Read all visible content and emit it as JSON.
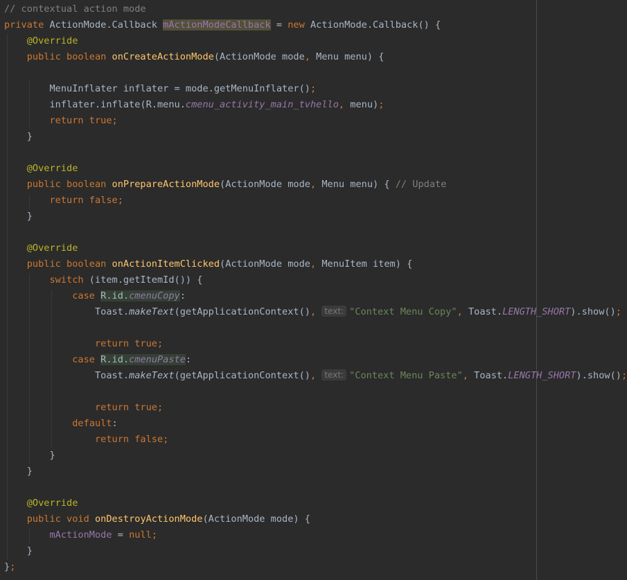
{
  "colors": {
    "background": "#2b2b2b",
    "default_text": "#a9b7c6",
    "keyword": "#cc7832",
    "comment": "#808080",
    "annotation": "#bbb529",
    "method": "#ffc66d",
    "field": "#9876aa",
    "string": "#6a8759"
  },
  "code": {
    "lines": [
      {
        "tokens": [
          {
            "t": "// contextual action mode",
            "c": "cm"
          }
        ]
      },
      {
        "tokens": [
          {
            "t": "private",
            "c": "kw"
          },
          {
            "t": " ActionMode.Callback "
          },
          {
            "t": "mActionModeCallback",
            "c": "fld hl-var"
          },
          {
            "t": " = "
          },
          {
            "t": "new",
            "c": "kw"
          },
          {
            "t": " ActionMode.Callback() {"
          }
        ]
      },
      {
        "tokens": [
          {
            "t": "    "
          },
          {
            "t": "@Override",
            "c": "an"
          }
        ]
      },
      {
        "tokens": [
          {
            "t": "    "
          },
          {
            "t": "public boolean",
            "c": "kw"
          },
          {
            "t": " "
          },
          {
            "t": "onCreateActionMode",
            "c": "fn"
          },
          {
            "t": "(ActionMode mode"
          },
          {
            "t": ",",
            "c": "kw"
          },
          {
            "t": " Menu menu) {"
          }
        ]
      },
      {
        "tokens": []
      },
      {
        "tokens": [
          {
            "t": "        MenuInflater inflater = mode.getMenuInflater()"
          },
          {
            "t": ";",
            "c": "kw"
          }
        ]
      },
      {
        "tokens": [
          {
            "t": "        inflater.inflate(R.menu."
          },
          {
            "t": "cmenu_activity_main_tvhello",
            "c": "ital"
          },
          {
            "t": ", ",
            "c": "kw"
          },
          {
            "t": "menu)"
          },
          {
            "t": ";",
            "c": "kw"
          }
        ]
      },
      {
        "tokens": [
          {
            "t": "        "
          },
          {
            "t": "return true;",
            "c": "kw"
          }
        ]
      },
      {
        "tokens": [
          {
            "t": "    }"
          }
        ]
      },
      {
        "tokens": []
      },
      {
        "tokens": [
          {
            "t": "    "
          },
          {
            "t": "@Override",
            "c": "an"
          }
        ]
      },
      {
        "tokens": [
          {
            "t": "    "
          },
          {
            "t": "public boolean",
            "c": "kw"
          },
          {
            "t": " "
          },
          {
            "t": "onPrepareActionMode",
            "c": "fn"
          },
          {
            "t": "(ActionMode mode"
          },
          {
            "t": ",",
            "c": "kw"
          },
          {
            "t": " Menu menu) { "
          },
          {
            "t": "// Update",
            "c": "cm"
          }
        ]
      },
      {
        "tokens": [
          {
            "t": "        "
          },
          {
            "t": "return false;",
            "c": "kw"
          }
        ]
      },
      {
        "tokens": [
          {
            "t": "    }"
          }
        ]
      },
      {
        "tokens": []
      },
      {
        "tokens": [
          {
            "t": "    "
          },
          {
            "t": "@Override",
            "c": "an"
          }
        ]
      },
      {
        "tokens": [
          {
            "t": "    "
          },
          {
            "t": "public boolean",
            "c": "kw"
          },
          {
            "t": " "
          },
          {
            "t": "onActionItemClicked",
            "c": "fn"
          },
          {
            "t": "(ActionMode mode"
          },
          {
            "t": ",",
            "c": "kw"
          },
          {
            "t": " MenuItem item) {"
          }
        ]
      },
      {
        "tokens": [
          {
            "t": "        "
          },
          {
            "t": "switch",
            "c": "kw"
          },
          {
            "t": " (item.getItemId()) {"
          }
        ]
      },
      {
        "tokens": [
          {
            "t": "            "
          },
          {
            "t": "case",
            "c": "kw"
          },
          {
            "t": " "
          },
          {
            "t": "R.id.",
            "c": "hl-ref"
          },
          {
            "t": "cmenuCopy",
            "c": "ital hl-ref"
          },
          {
            "t": ":"
          }
        ]
      },
      {
        "tokens": [
          {
            "t": "                Toast."
          },
          {
            "t": "makeText",
            "c": "sm"
          },
          {
            "t": "(getApplicationContext()"
          },
          {
            "t": ",",
            "c": "kw"
          },
          {
            "t": " "
          },
          {
            "t": "text:",
            "c": "hint"
          },
          {
            "t": "\"Context Menu Copy\"",
            "c": "str"
          },
          {
            "t": ",",
            "c": "kw"
          },
          {
            "t": " Toast."
          },
          {
            "t": "LENGTH_SHORT",
            "c": "ital"
          },
          {
            "t": ").show()"
          },
          {
            "t": ";",
            "c": "kw"
          }
        ]
      },
      {
        "tokens": []
      },
      {
        "tokens": [
          {
            "t": "                "
          },
          {
            "t": "return true;",
            "c": "kw"
          }
        ]
      },
      {
        "tokens": [
          {
            "t": "            "
          },
          {
            "t": "case",
            "c": "kw"
          },
          {
            "t": " "
          },
          {
            "t": "R.id.",
            "c": "hl-ref"
          },
          {
            "t": "cmenuPaste",
            "c": "ital hl-ref"
          },
          {
            "t": ":"
          }
        ]
      },
      {
        "tokens": [
          {
            "t": "                Toast."
          },
          {
            "t": "makeText",
            "c": "sm"
          },
          {
            "t": "(getApplicationContext()"
          },
          {
            "t": ",",
            "c": "kw"
          },
          {
            "t": " "
          },
          {
            "t": "text:",
            "c": "hint"
          },
          {
            "t": "\"Context Menu Paste\"",
            "c": "str"
          },
          {
            "t": ",",
            "c": "kw"
          },
          {
            "t": " Toast."
          },
          {
            "t": "LENGTH_SHORT",
            "c": "ital"
          },
          {
            "t": ").show()"
          },
          {
            "t": ";",
            "c": "kw"
          }
        ]
      },
      {
        "tokens": []
      },
      {
        "tokens": [
          {
            "t": "                "
          },
          {
            "t": "return true;",
            "c": "kw"
          }
        ]
      },
      {
        "tokens": [
          {
            "t": "            "
          },
          {
            "t": "default",
            "c": "kw"
          },
          {
            "t": ":"
          }
        ]
      },
      {
        "tokens": [
          {
            "t": "                "
          },
          {
            "t": "return false;",
            "c": "kw"
          }
        ]
      },
      {
        "tokens": [
          {
            "t": "        }"
          }
        ]
      },
      {
        "tokens": [
          {
            "t": "    }"
          }
        ]
      },
      {
        "tokens": []
      },
      {
        "tokens": [
          {
            "t": "    "
          },
          {
            "t": "@Override",
            "c": "an"
          }
        ]
      },
      {
        "tokens": [
          {
            "t": "    "
          },
          {
            "t": "public void",
            "c": "kw"
          },
          {
            "t": " "
          },
          {
            "t": "onDestroyActionMode",
            "c": "fn"
          },
          {
            "t": "(ActionMode mode) {"
          }
        ]
      },
      {
        "tokens": [
          {
            "t": "        "
          },
          {
            "t": "mActionMode",
            "c": "fld"
          },
          {
            "t": " = "
          },
          {
            "t": "null;",
            "c": "kw"
          }
        ]
      },
      {
        "tokens": [
          {
            "t": "    }"
          }
        ]
      },
      {
        "tokens": [
          {
            "t": "}"
          },
          {
            "t": ";",
            "c": "kw"
          }
        ]
      }
    ]
  }
}
